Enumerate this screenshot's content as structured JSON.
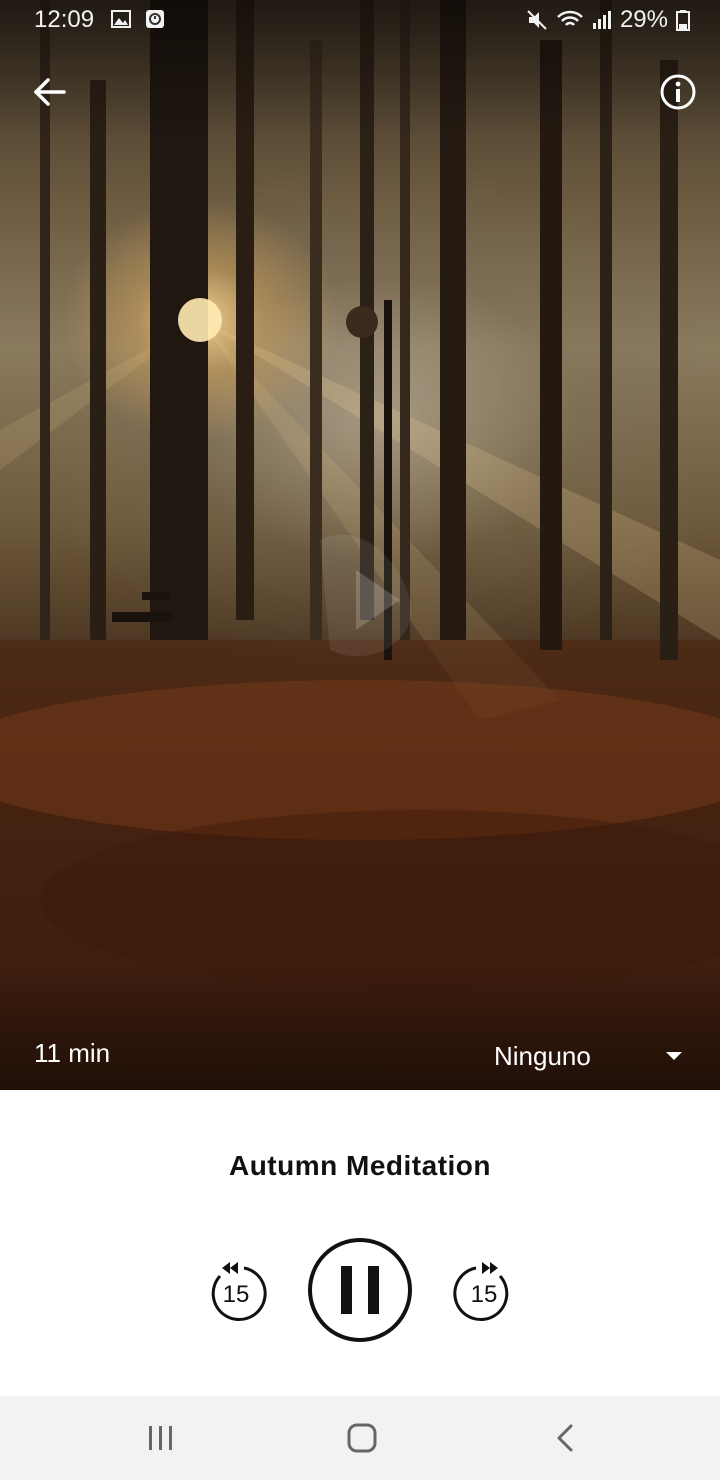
{
  "status_bar": {
    "time": "12:09",
    "battery": "29%",
    "icons_left": [
      "image-icon",
      "clock-app-icon"
    ],
    "icons_right": [
      "mute-icon",
      "wifi-icon",
      "signal-icon",
      "battery-icon"
    ]
  },
  "top_bar": {
    "back_icon": "arrow-left-icon",
    "info_icon": "info-icon"
  },
  "hero": {
    "description_icon": "play-overlay-icon",
    "duration": "11 min",
    "sound_select": {
      "value": "Ninguno"
    }
  },
  "player": {
    "title": "Autumn Meditation",
    "rewind_label": "15",
    "forward_label": "15",
    "state_icon": "pause-icon"
  },
  "colors": {
    "title_text": "#111111",
    "controls": "#111111",
    "nav_bar": "#f2f2f2"
  }
}
